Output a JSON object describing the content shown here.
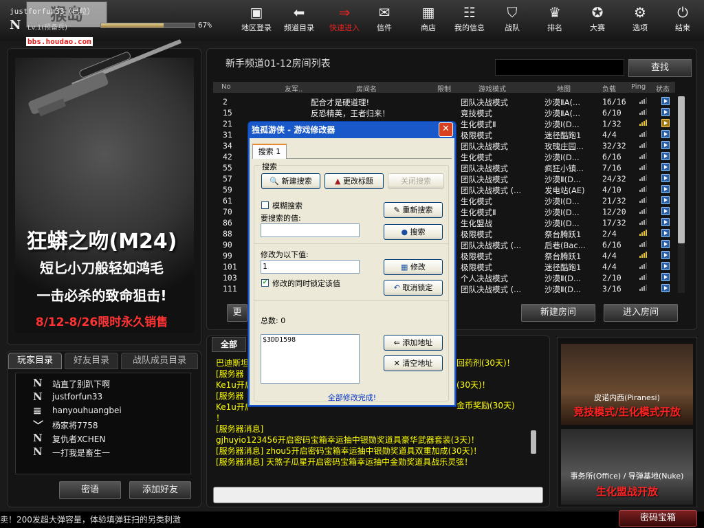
{
  "user": {
    "name": "justforfun33（已位）",
    "rank_glyph": "N",
    "level": "Lv.1(预备兵)",
    "exp_pct_text": "67%",
    "exp_fraction": 0.67
  },
  "logo": {
    "text": "猴岛",
    "url": "bbs.houdao.com"
  },
  "nav": [
    {
      "label": "地区登录",
      "icon": "region-login-icon",
      "glyph": "▣"
    },
    {
      "label": "频道目录",
      "icon": "back-arrow-icon",
      "glyph": "⬅"
    },
    {
      "label": "快速进入",
      "icon": "fast-forward-icon",
      "glyph": "⇒"
    },
    {
      "label": "信件",
      "icon": "mail-icon",
      "glyph": "✉"
    },
    {
      "label": "商店",
      "icon": "shop-icon",
      "glyph": "▦"
    },
    {
      "label": "我的信息",
      "icon": "profile-icon",
      "glyph": "☷"
    },
    {
      "label": "战队",
      "icon": "clan-shield-icon",
      "glyph": "⛉"
    },
    {
      "label": "排名",
      "icon": "trophy-icon",
      "glyph": "♛"
    },
    {
      "label": "大赛",
      "icon": "medal-icon",
      "glyph": "✪"
    },
    {
      "label": "选项",
      "icon": "gear-icon",
      "glyph": "⚙"
    },
    {
      "label": "结束",
      "icon": "power-icon",
      "glyph": "⏻"
    }
  ],
  "ad_left": {
    "title": "狂蟒之吻(M24)",
    "sub1": "短匕小刀般轻如鸿毛",
    "sub2": "一击必杀的致命狙击!",
    "date": "8/12-8/26限时永久销售"
  },
  "room_list": {
    "title": "新手频道01-12房间列表",
    "search_label": "查找",
    "headers": [
      "No",
      "友军..",
      "房间名",
      "限制",
      "游戏模式",
      "地图",
      "负载",
      "Ping",
      "状态"
    ],
    "rows": [
      {
        "no": "2",
        "name": "配合才是硬道理!",
        "mode": "团队决战模式",
        "map": "沙漠ⅡA(...",
        "load": "16/16",
        "ping": 3,
        "lock": false
      },
      {
        "no": "15",
        "name": "反恐精英，王者归来！",
        "mode": "竞技模式",
        "map": "沙漠ⅡA(...",
        "load": "6/10",
        "ping": 3,
        "lock": false
      },
      {
        "no": "21",
        "name": "",
        "mode": "生化模式Ⅱ",
        "map": "沙漠Ⅰ(D...",
        "load": "1/32",
        "ping": 4,
        "lock": true
      },
      {
        "no": "31",
        "name": "",
        "mode": "极限模式",
        "map": "迷径酷跑1",
        "load": "4/4",
        "ping": 3,
        "lock": false
      },
      {
        "no": "34",
        "name": "",
        "mode": "团队决战模式",
        "map": "玫瑰庄园...",
        "load": "32/32",
        "ping": 3,
        "lock": false
      },
      {
        "no": "42",
        "name": "",
        "mode": "生化模式",
        "map": "沙漠Ⅰ(D...",
        "load": "6/16",
        "ping": 3,
        "lock": false
      },
      {
        "no": "55",
        "name": "",
        "mode": "团队决战模式",
        "map": "疯狂小镇...",
        "load": "7/16",
        "ping": 3,
        "lock": false
      },
      {
        "no": "57",
        "name": "",
        "mode": "团队决战模式",
        "map": "沙漠Ⅱ(D...",
        "load": "24/32",
        "ping": 3,
        "lock": false
      },
      {
        "no": "59",
        "name": "",
        "mode": "团队决战模式 (...",
        "map": "发电站(AE)",
        "load": "4/10",
        "ping": 3,
        "lock": false
      },
      {
        "no": "61",
        "name": "",
        "mode": "生化模式",
        "map": "沙漠Ⅰ(D...",
        "load": "21/32",
        "ping": 3,
        "lock": false
      },
      {
        "no": "70",
        "name": "",
        "mode": "生化模式Ⅱ",
        "map": "沙漠Ⅰ(D...",
        "load": "12/20",
        "ping": 3,
        "lock": false
      },
      {
        "no": "86",
        "name": "",
        "mode": "生化盟战",
        "map": "沙漠Ⅰ(D...",
        "load": "17/32",
        "ping": 3,
        "lock": false
      },
      {
        "no": "88",
        "name": "",
        "mode": "极限模式",
        "map": "祭台腾跃1",
        "load": "2/4",
        "ping": 4,
        "lock": false
      },
      {
        "no": "90",
        "name": "",
        "mode": "团队决战模式 (...",
        "map": "后巷(Bac...",
        "load": "6/16",
        "ping": 3,
        "lock": false
      },
      {
        "no": "99",
        "name": "",
        "mode": "极限模式",
        "map": "祭台腾跃1",
        "load": "4/4",
        "ping": 4,
        "lock": false
      },
      {
        "no": "101",
        "name": "",
        "mode": "极限模式",
        "map": "迷径酷跑1",
        "load": "4/4",
        "ping": 3,
        "lock": false
      },
      {
        "no": "103",
        "name": "",
        "mode": "个人决战模式",
        "map": "沙漠Ⅱ(D...",
        "load": "2/10",
        "ping": 3,
        "lock": false
      },
      {
        "no": "111",
        "name": "",
        "mode": "团队决战模式 (...",
        "map": "沙漠Ⅱ(D...",
        "load": "3/16",
        "ping": 3,
        "lock": false
      }
    ],
    "refresh_label": "更",
    "new_room_label": "新建房间",
    "enter_room_label": "进入房间"
  },
  "chat": {
    "tab_label": "全部",
    "lines": [
      "巴迪斯坦",
      "[服务器",
      "Ke1u开启",
      "[服务器",
      "Ke1u开启",
      "！",
      "[服务器消息]",
      "gjhuyio123456开启密码宝箱幸运抽中银勋奖道具豪华武器套装(3天)！",
      "[服务器消息] zhou5开启密码宝箱幸运抽中银勋奖道具双重加成(30天)！",
      "[服务器消息] 天煞子瓜星开启密码宝箱幸运抽中金勋奖道具战乐灵弦！"
    ],
    "right_fragments": [
      "回药剂(30天)！",
      "(30天)！",
      "金币奖励(30天)"
    ]
  },
  "players": {
    "tabs": [
      "玩家目录",
      "好友目录",
      "战队成员目录"
    ],
    "list": [
      {
        "glyph": "N",
        "name": "站直了别趴下啊"
      },
      {
        "glyph": "N",
        "name": "justforfun33"
      },
      {
        "glyph": "≣",
        "name": "hanyouhuangbei"
      },
      {
        "glyph": "﹀",
        "name": "杨家将7758"
      },
      {
        "glyph": "N",
        "name": "复仇者XCHEN"
      },
      {
        "glyph": "N",
        "name": "一打我是畜生一"
      }
    ],
    "whisper_label": "密语",
    "add_friend_label": "添加好友"
  },
  "ad_right": {
    "top_title": "皮诺内西(Piranesi)",
    "top_sub": "竞技模式/生化模式开放",
    "bottom_title": "事务所(Office) / 导弹基地(Nuke)",
    "bottom_sub": "生化盟战开放"
  },
  "ticker": "卖！200发超大弹容量，体验填弹狂扫的另类刺激",
  "mima_label": "密码宝箱",
  "dialog": {
    "title": "独孤游侠 -  游戏修改器",
    "tab": "搜索 1",
    "group_label": "搜索",
    "new_search": "新建搜索",
    "change_title": "更改标题",
    "close_search": "关闭搜索",
    "fuzzy_label": "模糊搜索",
    "research": "重新搜索",
    "search_value_label": "要搜索的值:",
    "search_value": "",
    "search": "搜索",
    "modify_label": "修改为以下值:",
    "modify_value": "1",
    "modify": "修改",
    "lock_label": "修改的同时锁定该值",
    "unlock": "取消锁定",
    "total_label": "总数: 0",
    "address": "$3DD1598",
    "add_address": "添加地址",
    "clear_address": "清空地址",
    "footer": "全部修改完成!"
  }
}
